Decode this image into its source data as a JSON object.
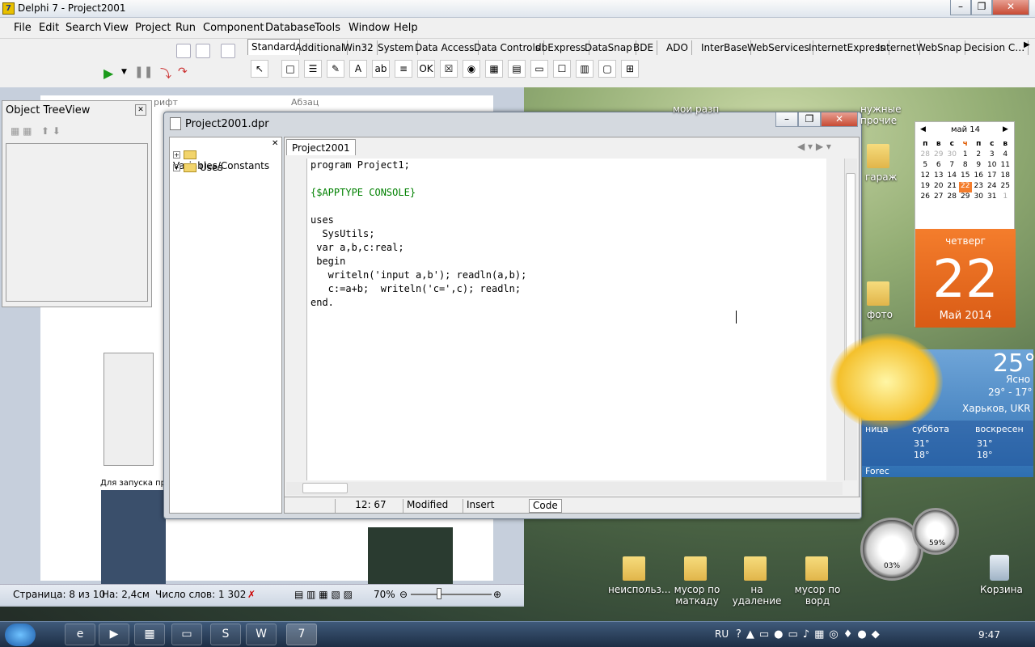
{
  "window": {
    "title": "Delphi 7 - Project2001",
    "icon_text": "7"
  },
  "menu": [
    "File",
    "Edit",
    "Search",
    "View",
    "Project",
    "Run",
    "Component",
    "Database",
    "Tools",
    "Window",
    "Help"
  ],
  "palette_tabs": [
    "Standard",
    "Additional",
    "Win32",
    "System",
    "Data Access",
    "Data Controls",
    "dbExpress",
    "DataSnap",
    "BDE",
    "ADO",
    "InterBase",
    "WebServices",
    "InternetExpress",
    "Internet",
    "WebSnap",
    "Decision C…"
  ],
  "components": [
    "↖",
    "□",
    "☰",
    "✎",
    "A",
    "ab",
    "≡",
    "OK",
    "☒",
    "◉",
    "▦",
    "▤",
    "▭",
    "☐",
    "▥",
    "▢",
    "⊞"
  ],
  "word": {
    "header_font": "рифт",
    "header_para": "Абзац",
    "text_run": "Для запуска прогр",
    "page": "Страница: 8 из 10",
    "pos": "На: 2,4см",
    "words": "Число слов: 1 302",
    "zoom": "70%",
    "zoom_fraction": 0.35
  },
  "treeview": {
    "title": "Object TreeView"
  },
  "project_window": {
    "title": "Project2001.dpr",
    "tab": "Project2001",
    "explorer": [
      "Variables/Constants",
      "Uses"
    ],
    "code": [
      {
        "text": "program Project1;",
        "color": "#000000"
      },
      {
        "text": "",
        "color": "#000000"
      },
      {
        "text": "{$APPTYPE CONSOLE}",
        "color": "#008000"
      },
      {
        "text": "",
        "color": "#000000"
      },
      {
        "text": "uses",
        "color": "#000000"
      },
      {
        "text": "  SysUtils;",
        "color": "#000000"
      },
      {
        "text": " var a,b,c:real;",
        "color": "#000000"
      },
      {
        "text": " begin",
        "color": "#000000"
      },
      {
        "text": "   writeln('input a,b'); readln(a,b);",
        "color": "#000000"
      },
      {
        "text": "   c:=a+b;  writeln('c=',c); readln;",
        "color": "#000000"
      },
      {
        "text": "end.",
        "color": "#000000"
      }
    ],
    "status": {
      "pos": "12: 67",
      "state": "Modified",
      "mode": "Insert",
      "view": "Code"
    }
  },
  "desktop_labels": {
    "top1": "мои разп",
    "top2": "нужные\nпрочие",
    "garazh": "гараж",
    "foto": "фото",
    "d1": "неиспольз...",
    "d2": "мусор по\nматкаду",
    "d3": "на удаление",
    "d4": "мусор по\nворд",
    "trash": "Корзина"
  },
  "calendar": {
    "month": "май 14",
    "weekdays": [
      "п",
      "в",
      "с",
      "ч",
      "п",
      "с",
      "в"
    ],
    "days": [
      "28",
      "29",
      "30",
      "1",
      "2",
      "3",
      "4",
      "5",
      "6",
      "7",
      "8",
      "9",
      "10",
      "11",
      "12",
      "13",
      "14",
      "15",
      "16",
      "17",
      "18",
      "19",
      "20",
      "21",
      "22",
      "23",
      "24",
      "25",
      "26",
      "27",
      "28",
      "29",
      "30",
      "31",
      "1"
    ],
    "today": "22",
    "weekday": "четверг",
    "monthyear": "Май 2014"
  },
  "weather": {
    "temp": "25°",
    "cond": "Ясно",
    "range": "29° - 17°",
    "city": "Харьков, UKR",
    "d1": "ница",
    "d2": "суббота",
    "d3": "воскресен",
    "hi2": "31°",
    "lo2": "18°",
    "hi3": "31°",
    "lo3": "18°",
    "src": "Forec"
  },
  "meters": {
    "cpu": "03%",
    "mem": "59%"
  },
  "taskbar": {
    "lang": "RU",
    "time": "9:47"
  }
}
